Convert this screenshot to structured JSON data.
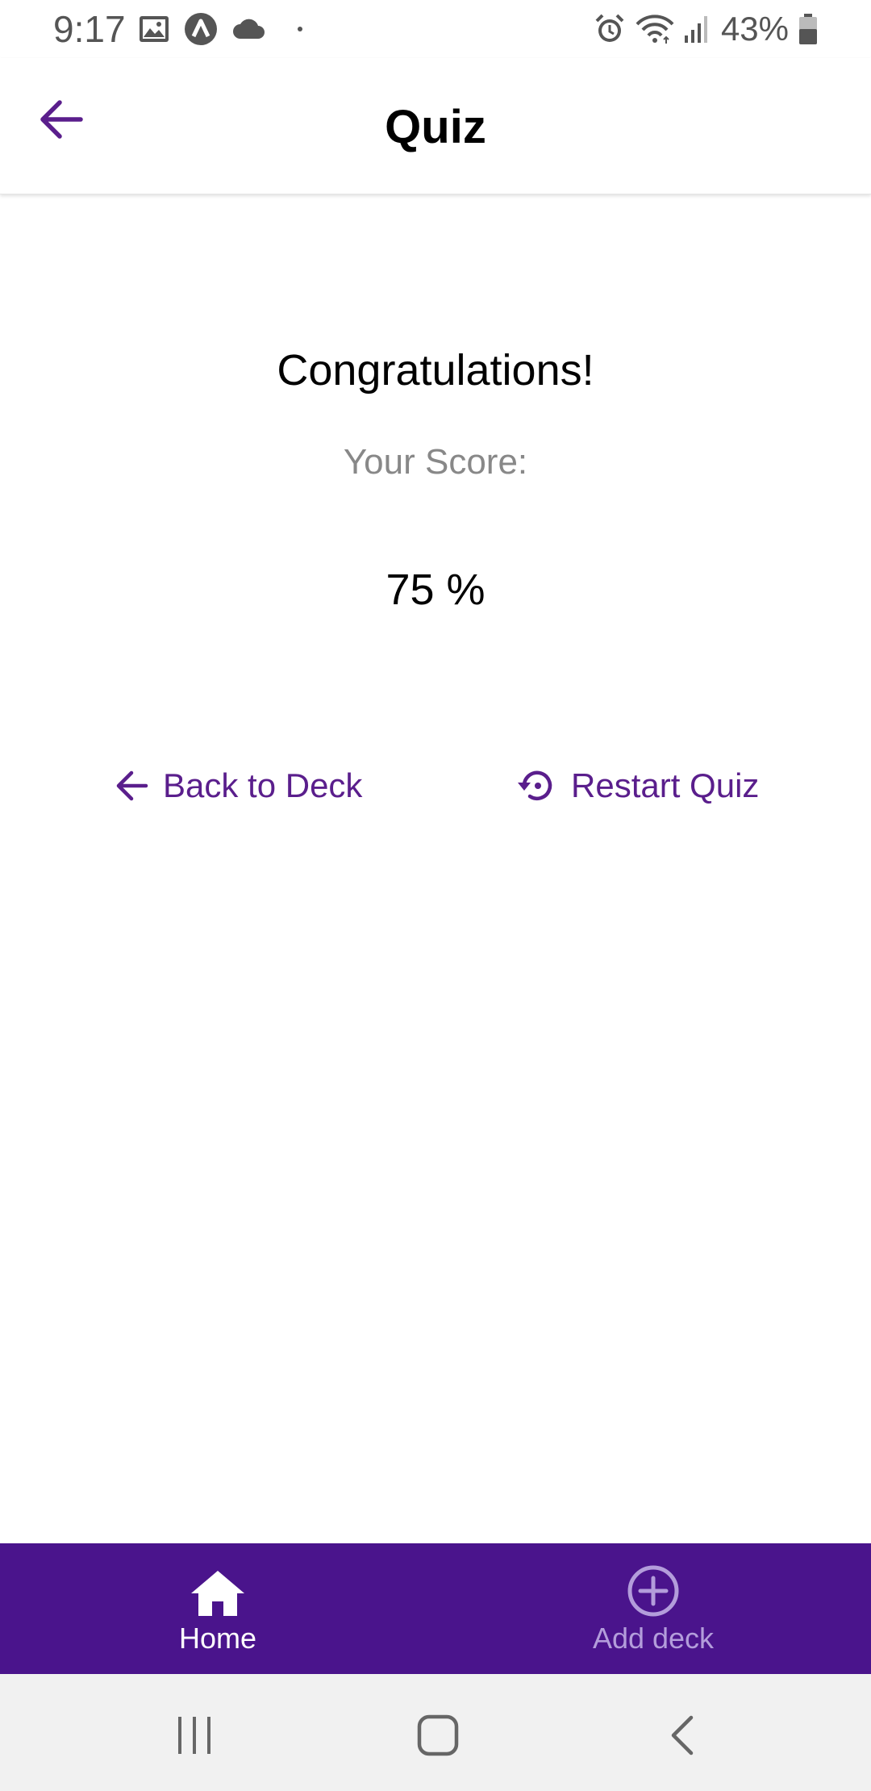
{
  "status_bar": {
    "time": "9:17",
    "battery": "43%",
    "left_icons": [
      "image-icon",
      "app-a-icon",
      "cloud-icon",
      "dot-icon"
    ],
    "right_icons": [
      "alarm-icon",
      "wifi-icon",
      "signal-icon",
      "battery-icon"
    ]
  },
  "app_bar": {
    "title": "Quiz",
    "back_icon": "arrow-left-icon"
  },
  "result": {
    "heading": "Congratulations!",
    "score_label": "Your Score:",
    "score_value": "75 %"
  },
  "actions": {
    "back_to_deck": "Back to Deck",
    "back_to_deck_icon": "arrow-left-icon",
    "restart_quiz": "Restart Quiz",
    "restart_quiz_icon": "restart-icon"
  },
  "bottom_nav": {
    "items": [
      {
        "label": "Home",
        "icon": "home-icon",
        "active": true
      },
      {
        "label": "Add deck",
        "icon": "add-circle-icon",
        "active": false
      }
    ]
  },
  "system_nav": {
    "buttons": [
      "recents-icon",
      "home-square-icon",
      "back-chevron-icon"
    ]
  },
  "colors": {
    "accent": "#5a1e8c",
    "nav_background": "#4a148c",
    "nav_inactive": "#b39ddb",
    "muted_text": "#888888"
  }
}
